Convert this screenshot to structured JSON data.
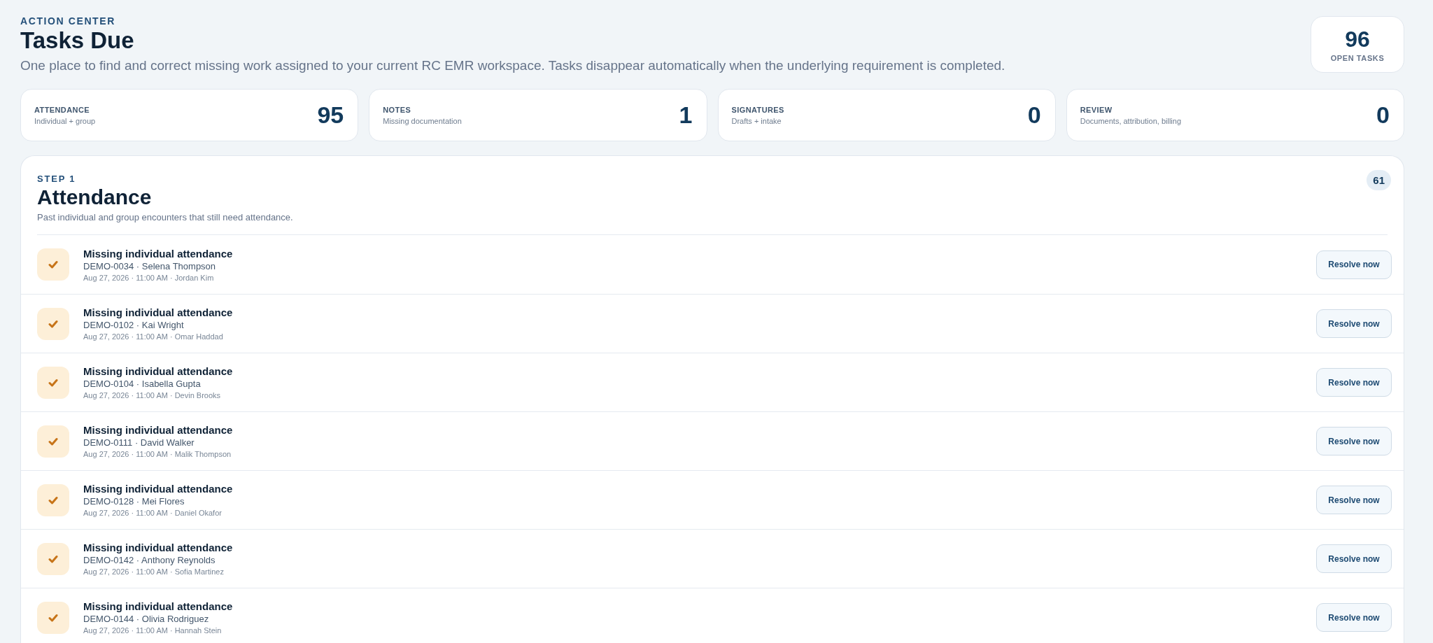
{
  "header": {
    "eyebrow": "ACTION CENTER",
    "title": "Tasks Due",
    "subtitle": "One place to find and correct missing work assigned to your current RC EMR workspace. Tasks disappear automatically when the underlying requirement is completed.",
    "open_count": "96",
    "open_label": "OPEN TASKS"
  },
  "stats": [
    {
      "label": "ATTENDANCE",
      "caption": "Individual + group",
      "count": "95"
    },
    {
      "label": "NOTES",
      "caption": "Missing documentation",
      "count": "1"
    },
    {
      "label": "SIGNATURES",
      "caption": "Drafts + intake",
      "count": "0"
    },
    {
      "label": "REVIEW",
      "caption": "Documents, attribution, billing",
      "count": "0"
    }
  ],
  "section": {
    "step": "STEP 1",
    "title": "Attendance",
    "description": "Past individual and group encounters that still need attendance.",
    "count": "61",
    "tasks": [
      {
        "title": "Missing individual attendance",
        "client": "DEMO-0034 · Selena Thompson",
        "meta": "Aug 27, 2026 · 11:00 AM · Jordan Kim",
        "action": "Resolve now"
      },
      {
        "title": "Missing individual attendance",
        "client": "DEMO-0102 · Kai Wright",
        "meta": "Aug 27, 2026 · 11:00 AM · Omar Haddad",
        "action": "Resolve now"
      },
      {
        "title": "Missing individual attendance",
        "client": "DEMO-0104 · Isabella Gupta",
        "meta": "Aug 27, 2026 · 11:00 AM · Devin Brooks",
        "action": "Resolve now"
      },
      {
        "title": "Missing individual attendance",
        "client": "DEMO-0111 · David Walker",
        "meta": "Aug 27, 2026 · 11:00 AM · Malik Thompson",
        "action": "Resolve now"
      },
      {
        "title": "Missing individual attendance",
        "client": "DEMO-0128 · Mei Flores",
        "meta": "Aug 27, 2026 · 11:00 AM · Daniel Okafor",
        "action": "Resolve now"
      },
      {
        "title": "Missing individual attendance",
        "client": "DEMO-0142 · Anthony Reynolds",
        "meta": "Aug 27, 2026 · 11:00 AM · Sofia Martinez",
        "action": "Resolve now"
      },
      {
        "title": "Missing individual attendance",
        "client": "DEMO-0144 · Olivia Rodriguez",
        "meta": "Aug 27, 2026 · 11:00 AM · Hannah Stein",
        "action": "Resolve now"
      }
    ]
  }
}
